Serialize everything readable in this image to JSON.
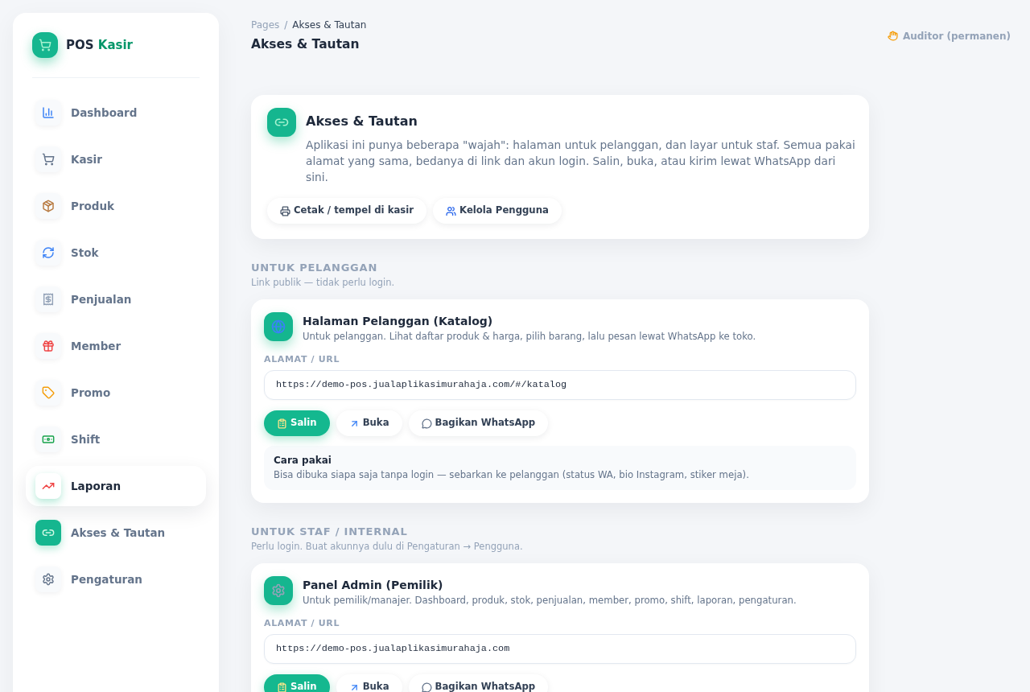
{
  "sidebar": {
    "brand": {
      "name": "POS",
      "accent": "Kasir"
    },
    "items": [
      {
        "label": "Dashboard",
        "selected": false,
        "hovered": false
      },
      {
        "label": "Kasir",
        "selected": false,
        "hovered": false
      },
      {
        "label": "Produk",
        "selected": false,
        "hovered": false
      },
      {
        "label": "Stok",
        "selected": false,
        "hovered": false
      },
      {
        "label": "Penjualan",
        "selected": false,
        "hovered": false
      },
      {
        "label": "Member",
        "selected": false,
        "hovered": false
      },
      {
        "label": "Promo",
        "selected": false,
        "hovered": false
      },
      {
        "label": "Shift",
        "selected": false,
        "hovered": false
      },
      {
        "label": "Laporan",
        "selected": false,
        "hovered": true
      },
      {
        "label": "Akses & Tautan",
        "selected": true,
        "hovered": false
      },
      {
        "label": "Pengaturan",
        "selected": false,
        "hovered": false
      }
    ]
  },
  "header": {
    "breadcrumb": {
      "items": [
        "Pages",
        "Akses & Tautan"
      ],
      "separator": "/"
    },
    "title": "Akses & Tautan",
    "user": "Auditor (permanen)"
  },
  "intro": {
    "title": "Akses & Tautan",
    "text": "Aplikasi ini punya beberapa \"wajah\": halaman untuk pelanggan, dan layar untuk staf. Semua pakai alamat yang sama, bedanya di link dan akun login. Salin, buka, atau kirim lewat WhatsApp dari sini.",
    "buttons": [
      "Cetak / tempel di kasir",
      "Kelola Pengguna"
    ]
  },
  "sections": [
    {
      "heading": "UNTUK PELANGGAN",
      "subtitle": "Link publik — tidak perlu login.",
      "cards": [
        {
          "title": "Halaman Pelanggan (Katalog)",
          "description": "Untuk pelanggan. Lihat daftar produk & harga, pilih barang, lalu pesan lewat WhatsApp ke toko.",
          "url_label": "ALAMAT / URL",
          "url": "https://demo-pos.jualaplikasimurahaja.com/#/katalog",
          "buttons": [
            {
              "label": "Salin",
              "kind": "primary"
            },
            {
              "label": "Buka",
              "kind": "secondary"
            },
            {
              "label": "Bagikan WhatsApp",
              "kind": "secondary"
            }
          ],
          "note": {
            "title": "Cara pakai",
            "text": "Bisa dibuka siapa saja tanpa login — sebarkan ke pelanggan (status WA, bio Instagram, stiker meja)."
          }
        }
      ]
    },
    {
      "heading": "UNTUK STAF / INTERNAL",
      "subtitle": "Perlu login. Buat akunnya dulu di Pengaturan → Pengguna.",
      "cards": [
        {
          "title": "Panel Admin (Pemilik)",
          "description": "Untuk pemilik/manajer. Dashboard, produk, stok, penjualan, member, promo, shift, laporan, pengaturan.",
          "url_label": "ALAMAT / URL",
          "url": "https://demo-pos.jualaplikasimurahaja.com",
          "buttons": [
            {
              "label": "Salin",
              "kind": "primary"
            },
            {
              "label": "Buka",
              "kind": "secondary"
            },
            {
              "label": "Bagikan WhatsApp",
              "kind": "secondary"
            }
          ]
        }
      ]
    }
  ]
}
